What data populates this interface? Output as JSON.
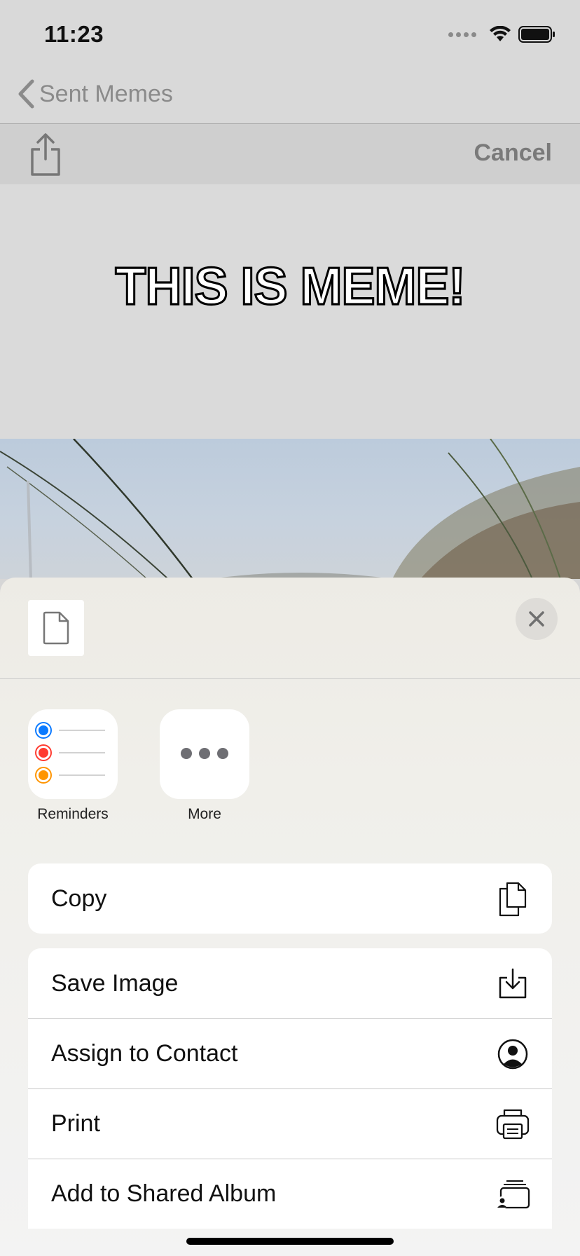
{
  "status_bar": {
    "time": "11:23"
  },
  "nav": {
    "back_label": "Sent Memes"
  },
  "toolbar": {
    "cancel_label": "Cancel"
  },
  "meme": {
    "top_text": "THIS IS MEME!"
  },
  "share_sheet": {
    "apps": [
      {
        "label": "Reminders",
        "icon": "reminders-icon"
      },
      {
        "label": "More",
        "icon": "more-icon"
      }
    ],
    "actions_group1": [
      {
        "label": "Copy",
        "icon": "copy-icon"
      }
    ],
    "actions_group2": [
      {
        "label": "Save Image",
        "icon": "save-image-icon"
      },
      {
        "label": "Assign to Contact",
        "icon": "contact-icon"
      },
      {
        "label": "Print",
        "icon": "print-icon"
      },
      {
        "label": "Add to Shared Album",
        "icon": "shared-album-icon"
      }
    ]
  },
  "colors": {
    "reminder_blue": "#0a7aff",
    "reminder_red": "#ff3b30",
    "reminder_orange": "#ff9500"
  }
}
